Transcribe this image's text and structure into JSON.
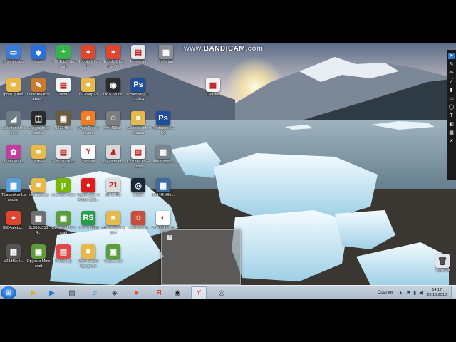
{
  "watermark": {
    "text": "www.",
    "brand": "BANDICAM",
    "suffix": ".com"
  },
  "desktop_icons": [
    {
      "label": "Компьютер",
      "icon": "computer-icon",
      "color": "#3a7bd5",
      "glyph": "▭"
    },
    {
      "label": "игра",
      "icon": "roblox-icon",
      "color": "#2b6fd8",
      "glyph": "◆"
    },
    {
      "label": "360 Total Security",
      "icon": "shield-plus-icon",
      "color": "#36b34a",
      "glyph": "+"
    },
    {
      "label": "Google Chrome",
      "icon": "chrome-icon",
      "color": "#e0452d",
      "glyph": "●"
    },
    {
      "label": "Google Chrome (2)",
      "icon": "chrome-icon",
      "color": "#e0452d",
      "glyph": "●"
    },
    {
      "label": "Minecraft",
      "icon": "document-icon",
      "color": "#e8e8e8",
      "glyph": "▤"
    },
    {
      "label": "vaSetup",
      "icon": "image-file-icon",
      "color": "#8a8f96",
      "glyph": "▦"
    },
    {
      "label": "фото флеш",
      "icon": "folder-icon",
      "color": "#e6b94a",
      "glyph": "■"
    },
    {
      "label": "Очистка времен...",
      "icon": "brush-icon",
      "color": "#c97b2d",
      "glyph": "✎"
    },
    {
      "label": "redir",
      "icon": "html-file-icon",
      "color": "#f2f2f2",
      "glyph": "▤"
    },
    {
      "label": "reGroup13",
      "icon": "folder-icon",
      "color": "#e6b94a",
      "glyph": "■"
    },
    {
      "label": "OBS Studio",
      "icon": "obs-icon",
      "color": "#2c2c2c",
      "glyph": "◉"
    },
    {
      "label": "Photoshop CS6 x64",
      "icon": "photoshop-icon",
      "color": "#1f4f9c",
      "glyph": "Ps"
    },
    {
      "label": "Снимок",
      "icon": "image-file-icon",
      "color": "#f2f2f2",
      "glyph": "▦"
    },
    {
      "label": "Counter-Strike 1.6",
      "icon": "counter-strike-icon",
      "color": "#6d7c86",
      "glyph": "◢"
    },
    {
      "label": "General Information",
      "icon": "steam-like-icon",
      "color": "#2a2a2a",
      "glyph": "◫"
    },
    {
      "label": "N4234f9...",
      "icon": "box-icon",
      "color": "#6d5b3d",
      "glyph": "▣"
    },
    {
      "label": "Avast Free Antivirus",
      "icon": "avast-icon",
      "color": "#f47b20",
      "glyph": "a"
    },
    {
      "label": "my1488a...",
      "icon": "user-icon",
      "color": "#7e7e7e",
      "glyph": "☺"
    },
    {
      "label": "General Information",
      "icon": "folder-icon",
      "color": "#e6b94a",
      "glyph": "■"
    },
    {
      "label": "Photoshop CS6",
      "icon": "photoshop-icon",
      "color": "#1f4f9c",
      "glyph": "Ps"
    },
    {
      "label": "375d0e89...",
      "icon": "colorful-icon",
      "color": "#c23fa0",
      "glyph": "✿"
    },
    {
      "label": "Игры",
      "icon": "folder-icon",
      "color": "#e6b94a",
      "glyph": "■"
    },
    {
      "label": "Roblox Studio",
      "icon": "document-icon",
      "color": "#e8e8e8",
      "glyph": "▤"
    },
    {
      "label": "Yandex",
      "icon": "yandex-icon",
      "color": "#ffffff",
      "glyph": "Y"
    },
    {
      "label": "eu_alldeaths",
      "icon": "figure-icon",
      "color": "#d8d8d8",
      "glyph": "♟"
    },
    {
      "label": "Ссылка на Roblox",
      "icon": "html-file-icon",
      "color": "#f2f2f2",
      "glyph": "▤"
    },
    {
      "label": "steamapps...",
      "icon": "screenshot-icon",
      "color": "#7a8590",
      "glyph": "▦"
    },
    {
      "label": "TLauncher Launcher",
      "icon": "tlauncher-icon",
      "color": "#5a9ed8",
      "glyph": "▩"
    },
    {
      "label": "программы",
      "icon": "folder-icon",
      "color": "#e6b94a",
      "glyph": "■"
    },
    {
      "label": "uTorrent Web",
      "icon": "utorrent-icon",
      "color": "#76b900",
      "glyph": "µ"
    },
    {
      "label": "HyperCam 5 Home Edit...",
      "icon": "hypercam-icon",
      "color": "#e01b1b",
      "glyph": "●"
    },
    {
      "label": "MPC-HC",
      "icon": "mpc-icon",
      "color": "#dedede",
      "glyph": "21"
    },
    {
      "label": "Steam",
      "icon": "steam-icon",
      "color": "#1b2838",
      "glyph": "◎"
    },
    {
      "label": "43d4f349fc...",
      "icon": "photo-icon",
      "color": "#3f6a9e",
      "glyph": "▦"
    },
    {
      "label": "6304afebc...",
      "icon": "chrome-icon",
      "color": "#e0452d",
      "glyph": "●"
    },
    {
      "label": "0c088c5534...",
      "icon": "photo-icon",
      "color": "#707070",
      "glyph": "▦"
    },
    {
      "label": "Оружия Minecraft",
      "icon": "minecraft-icon",
      "color": "#5c9c3b",
      "glyph": "▣"
    },
    {
      "label": "Ultra Studio",
      "icon": "rs-icon",
      "color": "#2a9d4a",
      "glyph": "RS"
    },
    {
      "label": "Моя Ютубе игры",
      "icon": "folder-icon",
      "color": "#e6b94a",
      "glyph": "■"
    },
    {
      "label": "Анимашка",
      "icon": "avatar-icon",
      "color": "#c84d3a",
      "glyph": "☺"
    },
    {
      "label": "Vkontakte DJ",
      "icon": "vk-icon",
      "color": "#ffffff",
      "glyph": "◐"
    },
    {
      "label": "e28df5e4...",
      "icon": "photo-icon",
      "color": "#555555",
      "glyph": "▦"
    },
    {
      "label": "Оружия Minecraft",
      "icon": "minecraft-icon",
      "color": "#5c9c3b",
      "glyph": "▣"
    },
    {
      "label": "Photo (2)",
      "icon": "photos-icon",
      "color": "#e04848",
      "glyph": "▤"
    },
    {
      "label": "Моя Ютубе Вредные",
      "icon": "folder-icon",
      "color": "#e6b94a",
      "glyph": "■"
    },
    {
      "label": "TLauncher",
      "icon": "minecraft-icon",
      "color": "#5c9c3b",
      "glyph": "▣"
    }
  ],
  "recycle_bin": {
    "label": "Корзина",
    "icon": "recycle-bin-icon"
  },
  "taskbar": {
    "start_icon": "windows-start-icon",
    "pinned": [
      {
        "name": "explorer",
        "icon": "explorer-icon",
        "glyph": "▶",
        "color": "#e0a830"
      },
      {
        "name": "media-player",
        "icon": "media-player-icon",
        "glyph": "▶",
        "color": "#1e6fd9"
      },
      {
        "name": "app",
        "icon": "app-icon",
        "glyph": "▤",
        "color": "#444"
      },
      {
        "name": "music",
        "icon": "music-icon",
        "glyph": "♫",
        "color": "#0f7fcf"
      },
      {
        "name": "network",
        "icon": "network-icon",
        "glyph": "◈",
        "color": "#444"
      },
      {
        "name": "chrome",
        "icon": "chrome-icon",
        "glyph": "●",
        "color": "#e0452d"
      },
      {
        "name": "yandex",
        "icon": "yandex-icon",
        "glyph": "Я",
        "color": "#e82a2a"
      },
      {
        "name": "obs",
        "icon": "obs-icon",
        "glyph": "◉",
        "color": "#222"
      },
      {
        "name": "yandex-browser",
        "icon": "yandex-browser-icon",
        "glyph": "Y",
        "color": "#e82a2a"
      },
      {
        "name": "bandicam",
        "icon": "bandicam-icon",
        "glyph": "◎",
        "color": "#444"
      }
    ],
    "tray_links": "Ссылки",
    "time": "14:17",
    "date": "28.10.2018"
  },
  "annotation_toolbar": {
    "tools": [
      "cursor-icon",
      "pen-icon",
      "pencil-icon",
      "line-icon",
      "brush-icon",
      "rectangle-icon",
      "circle-icon",
      "text-icon",
      "eraser-icon",
      "grid-icon",
      "clear-icon"
    ]
  }
}
